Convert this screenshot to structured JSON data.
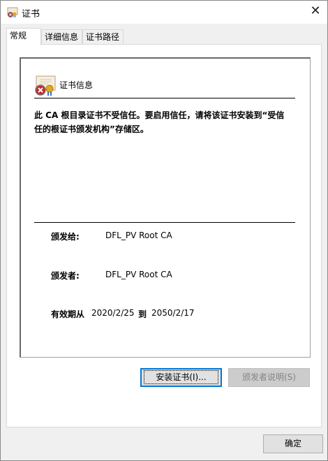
{
  "window": {
    "title": "证书",
    "close": "✕"
  },
  "tabs": [
    {
      "label": "常规"
    },
    {
      "label": "详细信息"
    },
    {
      "label": "证书路径"
    }
  ],
  "info": {
    "heading": "证书信息",
    "message": "此 CA 根目录证书不受信任。要启用信任，请将该证书安装到“受信任的根证书颁发机构”存储区。",
    "issued_to_label": "颁发给:",
    "issued_to": "DFL_PV Root CA",
    "issued_by_label": "颁发者:",
    "issued_by": "DFL_PV Root CA",
    "validity_label": "有效期从",
    "valid_from": "2020/2/25",
    "to_label": "到",
    "valid_to": "2050/2/17"
  },
  "buttons": {
    "install": "安装证书(I)...",
    "issuer_statement": "颁发者说明(S)",
    "ok": "确定"
  }
}
